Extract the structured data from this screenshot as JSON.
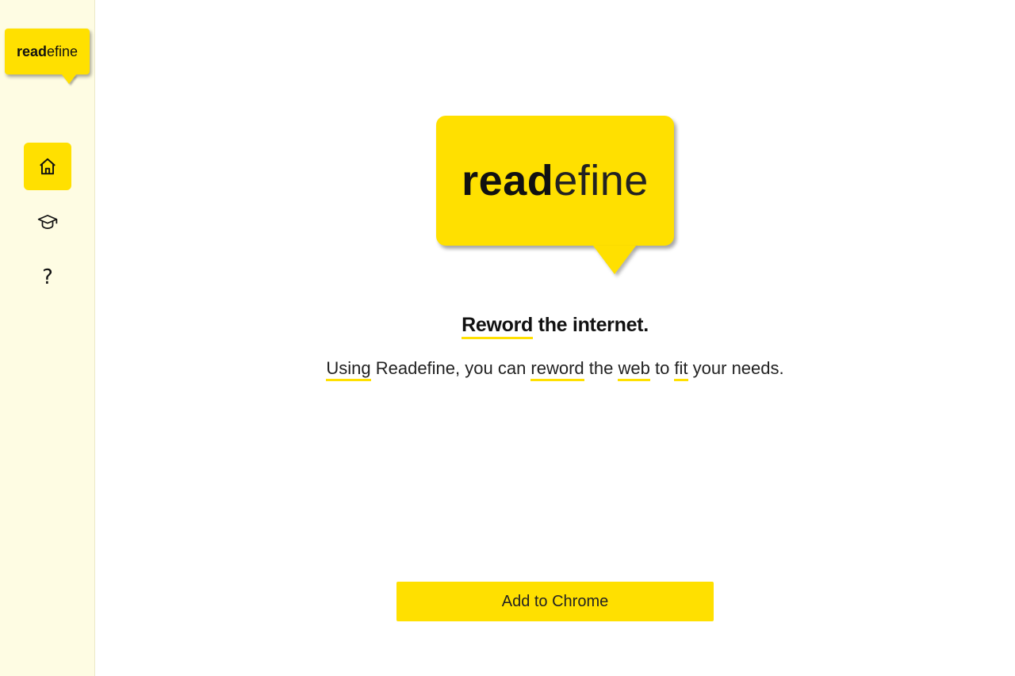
{
  "brand": {
    "logo_bold": "read",
    "logo_light": "efine",
    "accent_color": "#ffe000",
    "sidebar_bg": "#fefce3"
  },
  "sidebar": {
    "items": [
      {
        "icon": "home-icon",
        "active": true
      },
      {
        "icon": "graduation-cap-icon",
        "active": false
      },
      {
        "icon": "help-icon",
        "label": "?",
        "active": false
      }
    ]
  },
  "hero": {
    "tagline": {
      "highlight": "Reword",
      "rest": " the internet."
    },
    "subline": {
      "w1": "Using",
      "t1": " Readefine, you can ",
      "w2": "reword",
      "t2": " the ",
      "w3": "web",
      "t3": " to ",
      "w4": "fit",
      "t4": " your needs."
    }
  },
  "cta": {
    "label": "Add to Chrome"
  }
}
